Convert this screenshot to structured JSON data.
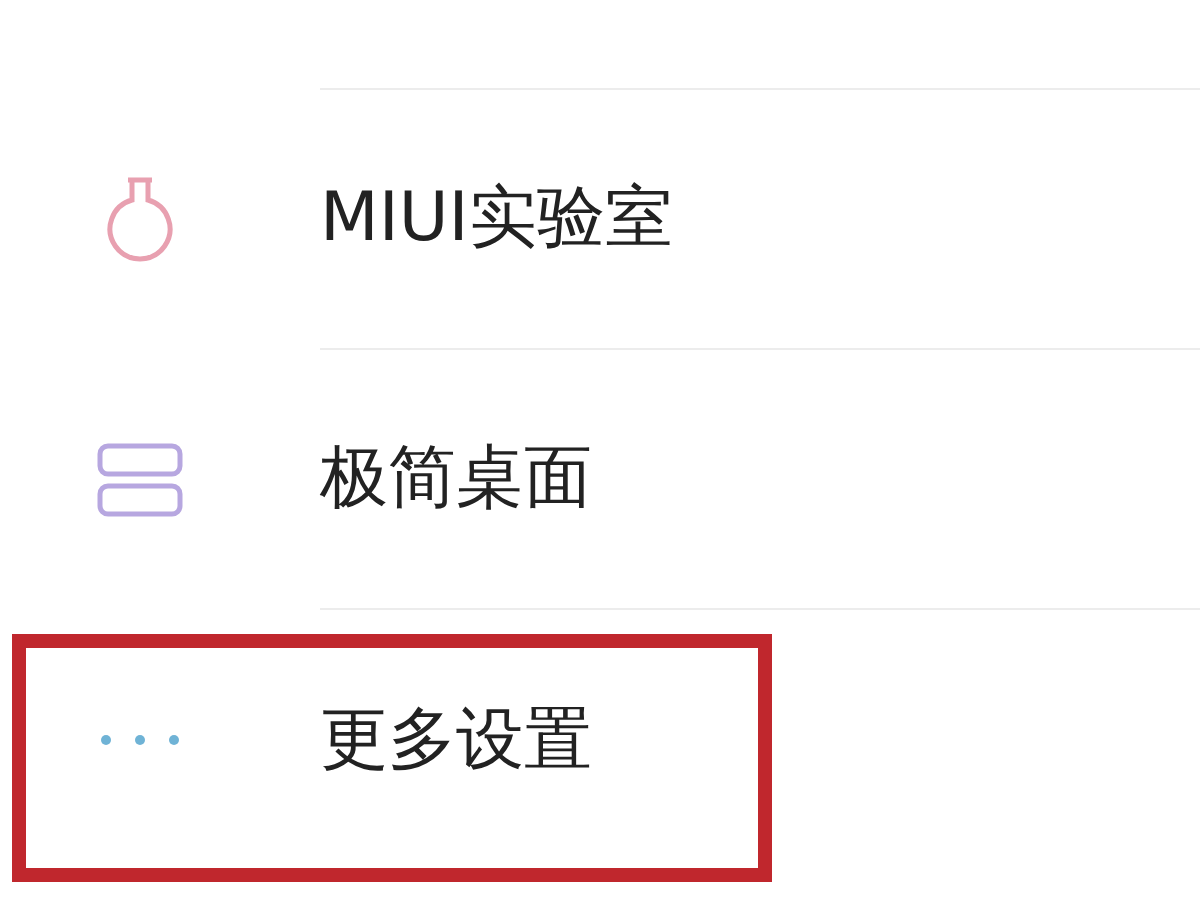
{
  "items": [
    {
      "label": "MIUI实验室",
      "kind": "flask",
      "highlighted": false
    },
    {
      "label": "极简桌面",
      "kind": "stack",
      "highlighted": false
    },
    {
      "label": "更多设置",
      "kind": "dots",
      "highlighted": true
    }
  ]
}
